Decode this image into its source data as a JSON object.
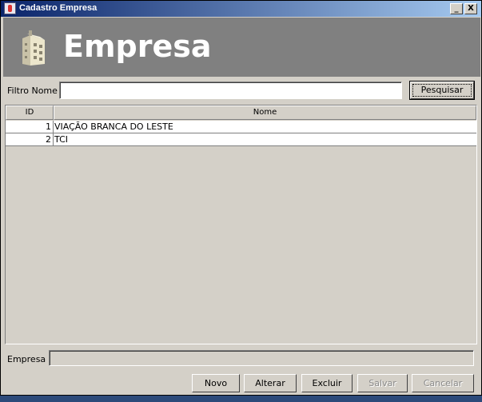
{
  "window": {
    "title": "Cadastro Empresa",
    "minimize": "_",
    "close": "X"
  },
  "banner": {
    "heading": "Empresa",
    "icon": "building-icon"
  },
  "filter": {
    "label": "Filtro Nome",
    "value": "",
    "search_button": "Pesquisar"
  },
  "table": {
    "columns": [
      "ID",
      "Nome"
    ],
    "rows": [
      {
        "id": "1",
        "nome": "VIAÇÃO BRANCA DO LESTE"
      },
      {
        "id": "2",
        "nome": "TCI"
      }
    ]
  },
  "form": {
    "empresa_label": "Empresa",
    "empresa_value": ""
  },
  "actions": {
    "novo": "Novo",
    "alterar": "Alterar",
    "excluir": "Excluir",
    "salvar": "Salvar",
    "cancelar": "Cancelar"
  }
}
